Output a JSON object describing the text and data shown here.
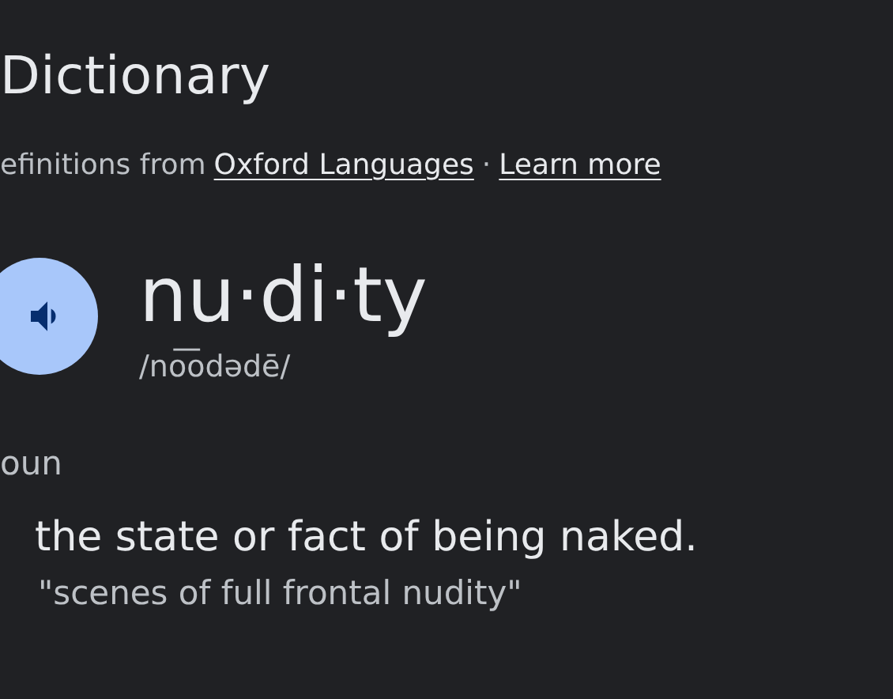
{
  "card": {
    "title": "Dictionary",
    "source": {
      "prefix": "efinitions from",
      "link": "Oxford Languages",
      "separator": "·",
      "learn_more": "Learn more"
    },
    "word": "nu·di·ty",
    "pronunciation": "/no͞odədē/",
    "part_of_speech": "oun",
    "definition": "the state or fact of being naked.",
    "example": "\"scenes of full frontal nudity\""
  }
}
